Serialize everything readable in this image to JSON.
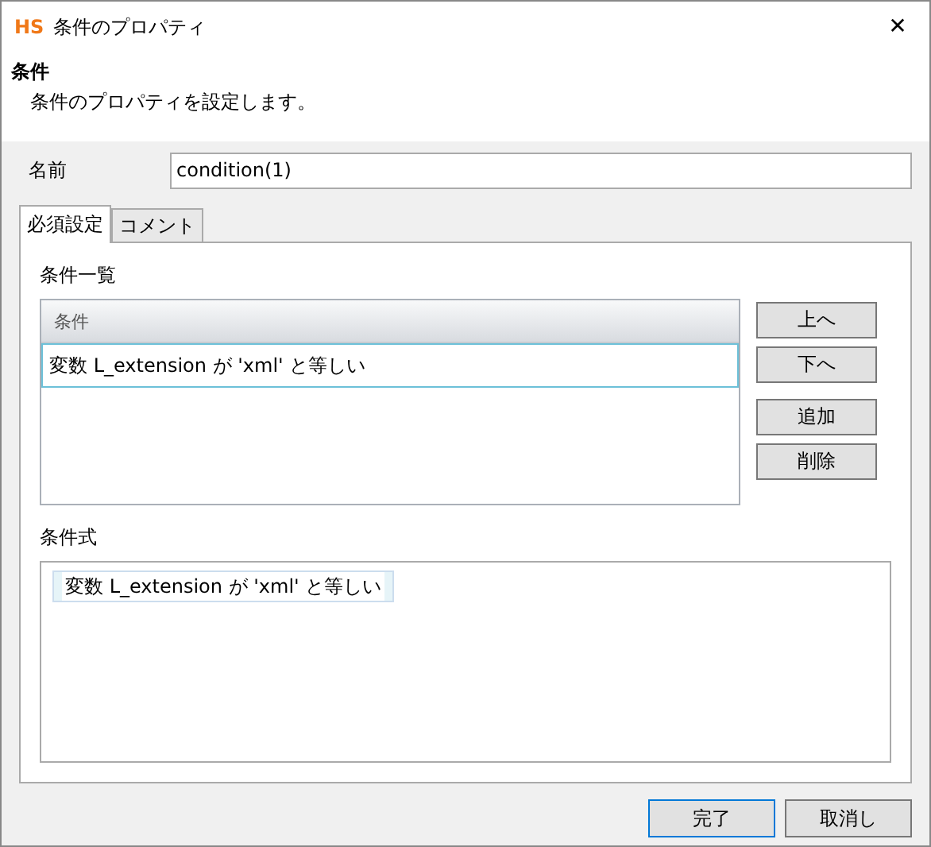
{
  "window": {
    "logo": "HS",
    "title": "条件のプロパティ",
    "close": "✕"
  },
  "header": {
    "title": "条件",
    "description": "条件のプロパティを設定します。"
  },
  "name_field": {
    "label": "名前",
    "value": "condition(1)"
  },
  "tabs": [
    {
      "label": "必須設定",
      "selected": true
    },
    {
      "label": "コメント",
      "selected": false
    }
  ],
  "condition_list": {
    "label": "条件一覧",
    "column": "条件",
    "rows": [
      {
        "text": "変数 L_extension が 'xml' と等しい",
        "selected": true
      }
    ]
  },
  "list_buttons": [
    "上へ",
    "下へ",
    "追加",
    "削除"
  ],
  "expression": {
    "label": "条件式",
    "tokens": [
      "変数 L_extension が 'xml' と等しい"
    ]
  },
  "footer_buttons": [
    {
      "label": "完了",
      "default": true
    },
    {
      "label": "取消し",
      "default": false
    }
  ]
}
